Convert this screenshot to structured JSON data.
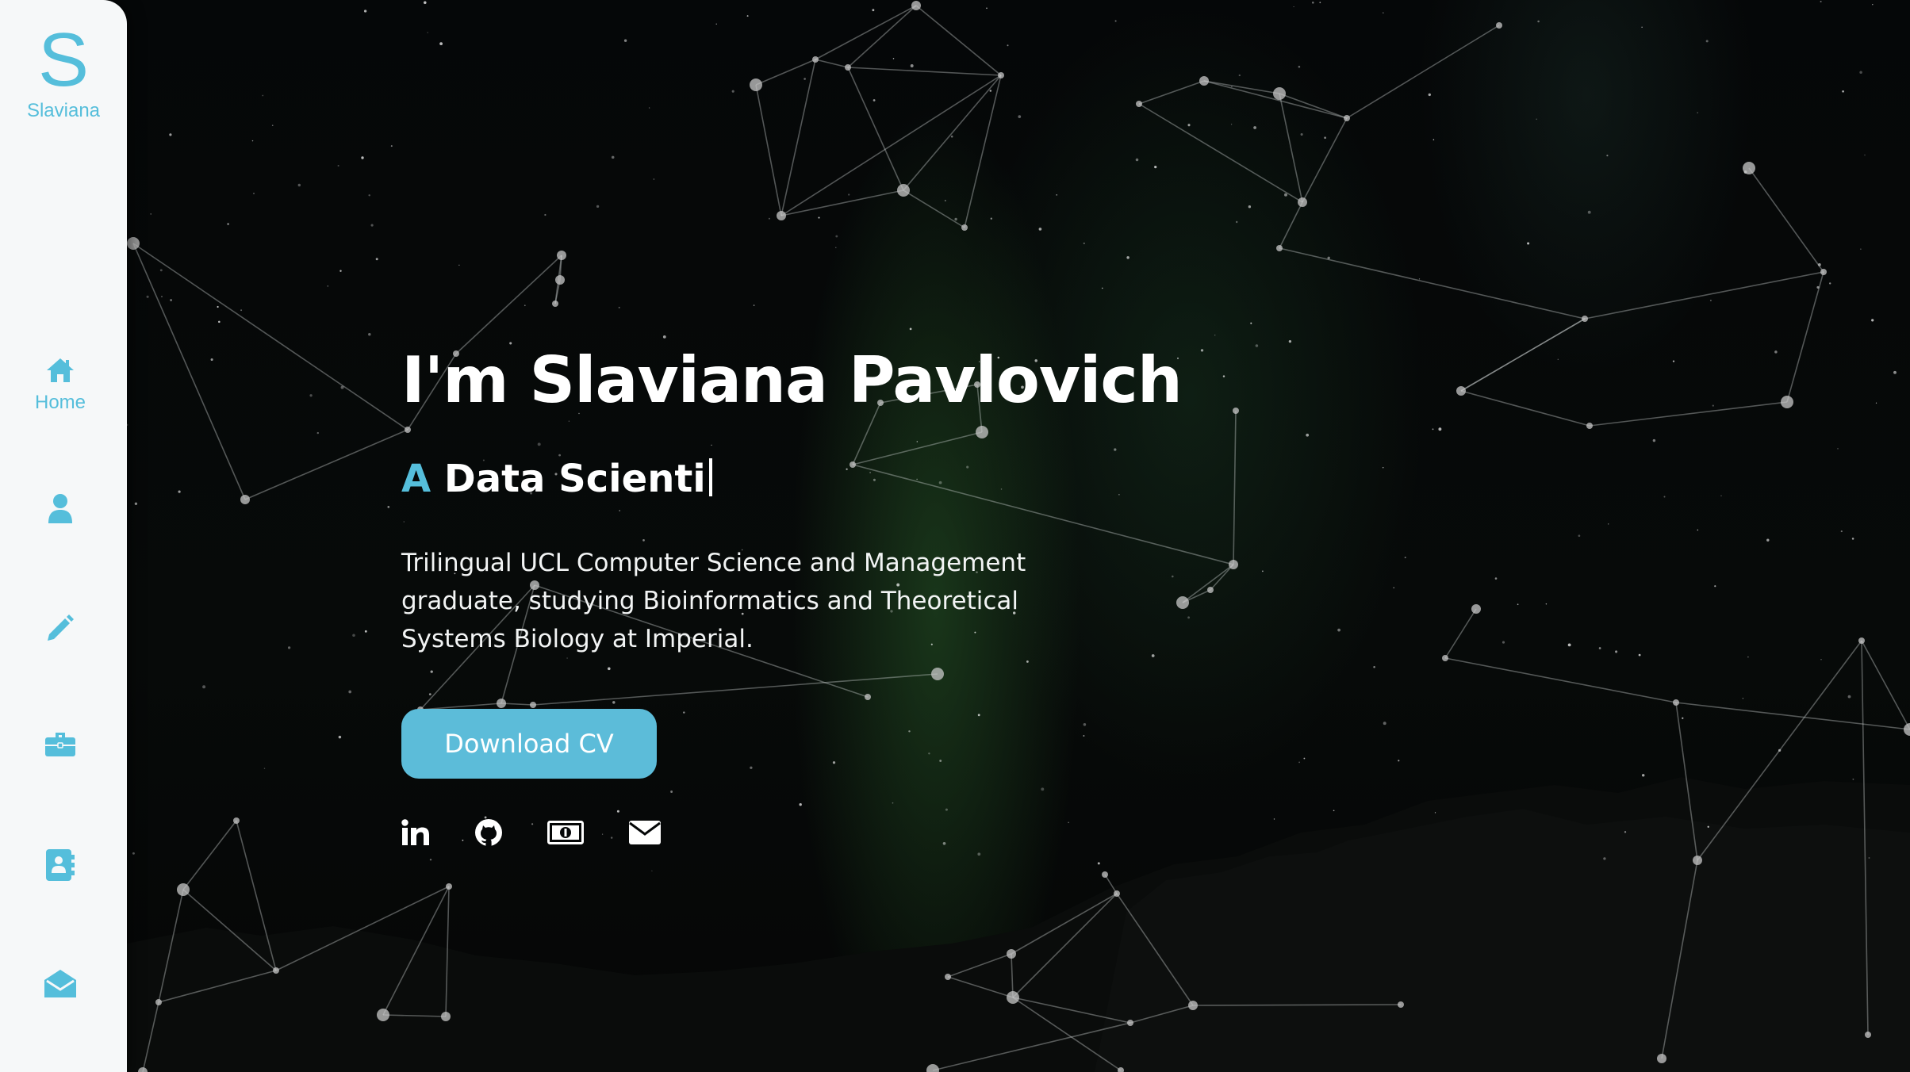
{
  "sidebar": {
    "logo_letter": "S",
    "logo_name": "Slaviana",
    "items": [
      {
        "icon": "home-icon",
        "label": "Home",
        "active": true
      },
      {
        "icon": "user-icon",
        "label": ""
      },
      {
        "icon": "pencil-icon",
        "label": ""
      },
      {
        "icon": "briefcase-icon",
        "label": ""
      },
      {
        "icon": "contact-book-icon",
        "label": ""
      },
      {
        "icon": "envelope-open-icon",
        "label": ""
      }
    ]
  },
  "hero": {
    "title": "I'm Slaviana Pavlovich",
    "subtitle_accent": "A",
    "subtitle_rest": "Data Scienti",
    "description": "Trilingual UCL Computer Science and Management graduate, studying Bioinformatics and Theoretical Systems Biology at Imperial.",
    "cv_button_label": "Download CV"
  },
  "socials": [
    {
      "icon": "linkedin-icon"
    },
    {
      "icon": "github-icon"
    },
    {
      "icon": "money-bill-icon"
    },
    {
      "icon": "envelope-icon"
    }
  ],
  "colors": {
    "accent": "#55bedb",
    "sidebar_bg": "#f6f8f9",
    "page_bg": "#050708",
    "text": "#ffffff"
  }
}
